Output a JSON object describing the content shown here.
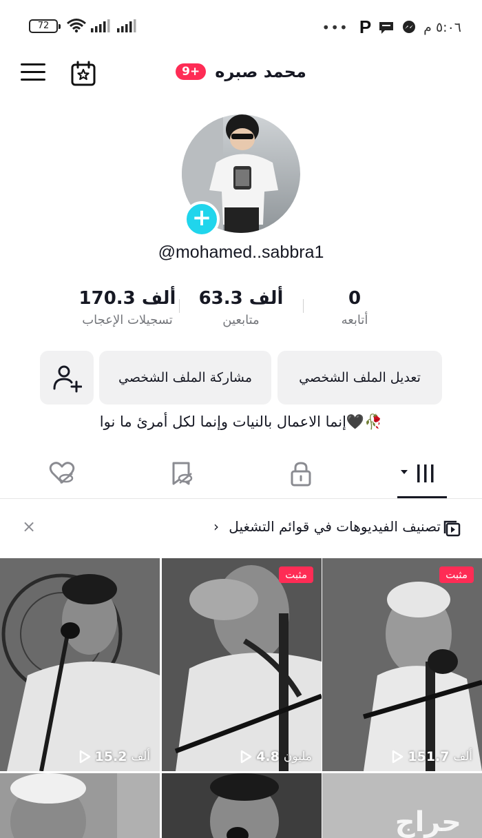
{
  "status_bar": {
    "battery": "72",
    "time": "٥:٠٦ م",
    "dots": "•••",
    "p_label": "P"
  },
  "header": {
    "title": "محمد صبره",
    "badge": "9+"
  },
  "profile": {
    "handle": "@mohamed..sabbra1",
    "stats": [
      {
        "value": "170.3 ألف",
        "label": "تسجيلات الإعجاب"
      },
      {
        "value": "63.3 ألف",
        "label": "متابعين"
      },
      {
        "value": "0",
        "label": "أتابعه"
      }
    ],
    "buttons": {
      "edit": "تعديل الملف الشخصي",
      "share": "مشاركة الملف الشخصي"
    },
    "bio": "إنما الاعمال بالنيات وإنما لكل أمرئ ما نوا🖤🥀"
  },
  "playlist_banner": {
    "text": "تصنيف الفيديوهات في قوائم التشغيل",
    "chevron": "›",
    "close": "×"
  },
  "videos": [
    {
      "pinned": "مثبت",
      "views": "151.7",
      "unit": "ألف"
    },
    {
      "pinned": "مثبت",
      "views": "4.8",
      "unit": "مليون"
    },
    {
      "pinned": "",
      "views": "15.2",
      "unit": "ألف"
    }
  ],
  "watermark": "حراج",
  "colors": {
    "accent": "#fe2c55",
    "avatar_add": "#20d5ec",
    "button_bg": "#f1f1f2"
  }
}
